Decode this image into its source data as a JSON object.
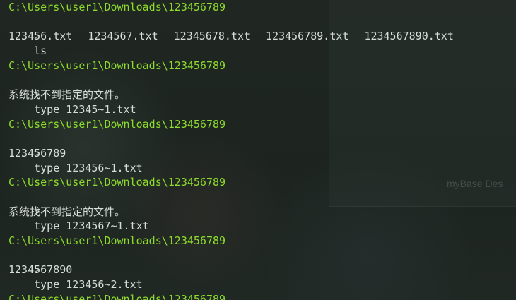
{
  "background": {
    "ghost_text": "myBase Des"
  },
  "terminal": {
    "path": "C:\\Users\\user1\\Downloads\\123456789",
    "prompt_symbol": ">",
    "commands": [
      "ls",
      "type 12345~1.txt",
      "type 123456~1.txt",
      "type 1234567~1.txt",
      "type 123456~2.txt"
    ],
    "ls_files": [
      "123456.txt",
      "1234567.txt",
      "12345678.txt",
      "123456789.txt",
      "1234567890.txt"
    ],
    "outputs": [
      "系统找不到指定的文件。",
      "123456789",
      "系统找不到指定的文件。",
      "1234567890"
    ]
  },
  "colors": {
    "path": "#8ddc2b",
    "text": "#d7ddd9"
  }
}
